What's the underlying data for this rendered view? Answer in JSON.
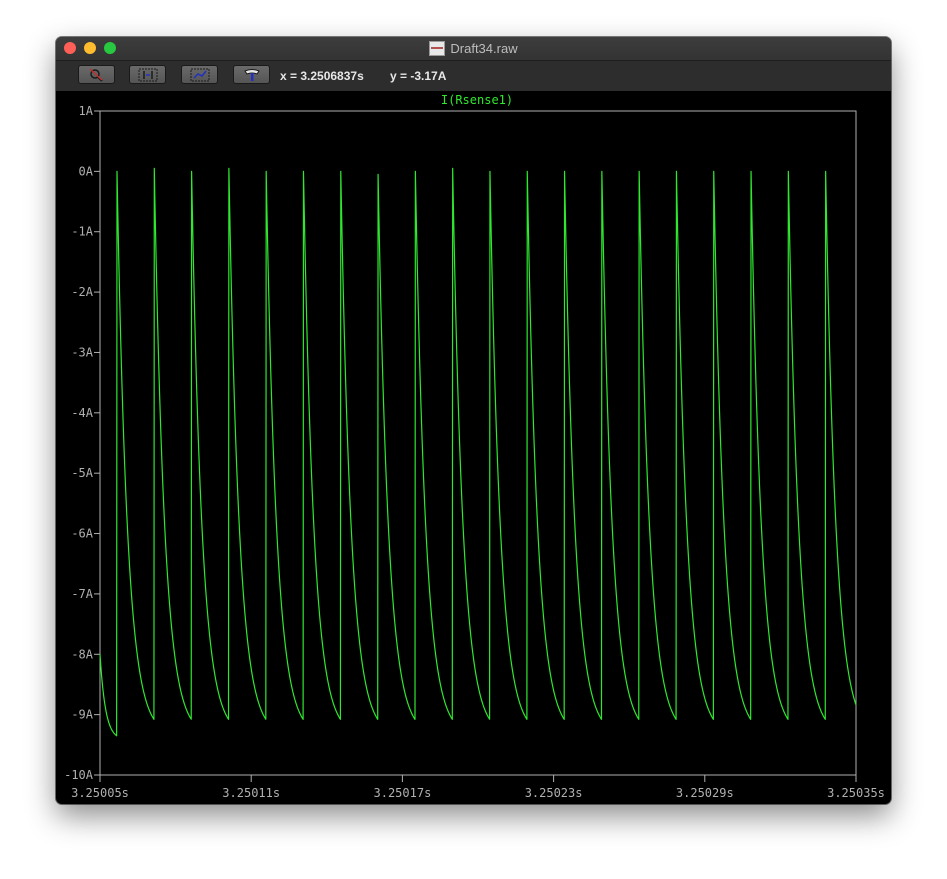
{
  "window": {
    "title": "Draft34.raw"
  },
  "toolbar": {
    "buttons": [
      {
        "icon": "zoom-icon"
      },
      {
        "icon": "autorange-icon"
      },
      {
        "icon": "pan-icon"
      },
      {
        "icon": "hammer-icon"
      }
    ],
    "cursor_x": "x = 3.2506837s",
    "cursor_y": "y = -3.17A"
  },
  "colors": {
    "background": "#000000",
    "trace": "#2ee82e",
    "axes": "#b0b0b0",
    "title_bar": "#333333"
  },
  "chart_data": {
    "type": "line",
    "title": "I(Rsense1)",
    "xlabel": "",
    "ylabel": "",
    "xlim": [
      3.25005,
      3.25035
    ],
    "ylim": [
      -10,
      1
    ],
    "x_ticks": [
      "3.25005s",
      "3.25011s",
      "3.25017s",
      "3.25023s",
      "3.25029s",
      "3.25035s"
    ],
    "y_ticks": [
      "1A",
      "0A",
      "-1A",
      "-2A",
      "-3A",
      "-4A",
      "-5A",
      "-6A",
      "-7A",
      "-8A",
      "-9A",
      "-10A"
    ],
    "grid": false,
    "series": [
      {
        "name": "I(Rsense1)",
        "shape": "periodic sawtooth",
        "start_value": -8.0,
        "peak_values": [
          0.0,
          0.05,
          0.0,
          0.05,
          0.0,
          0.0,
          0.0,
          -0.05,
          0.0,
          0.05,
          0.0,
          0.0,
          0.0,
          0.0,
          0.0,
          0.0,
          0.0,
          0.0,
          0.0,
          0.0
        ],
        "valley_value": -9.35,
        "end_value": -9.1,
        "period_s": 1.48e-05,
        "first_spike_s": 3.2500566
      }
    ]
  }
}
